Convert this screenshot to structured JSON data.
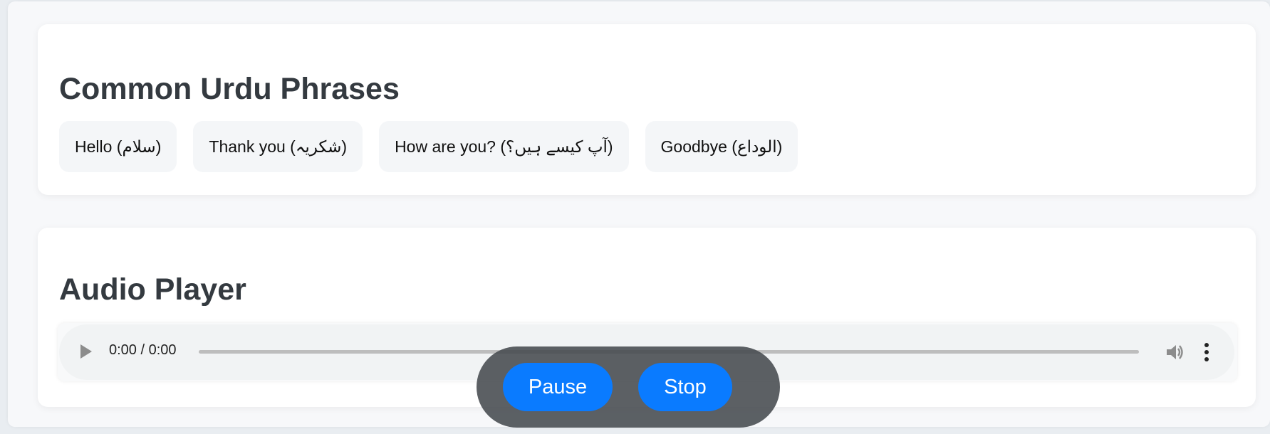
{
  "phrases_section": {
    "title": "Common Urdu Phrases",
    "phrases": [
      {
        "label": "Hello (سلام)"
      },
      {
        "label": "Thank you (شکریہ)"
      },
      {
        "label": "How are you? (آپ کیسے ہیں؟)"
      },
      {
        "label": "Goodbye (الوداع)"
      }
    ]
  },
  "audio_section": {
    "title": "Audio Player",
    "player": {
      "time_display": "0:00 / 0:00",
      "progress": 0,
      "play_icon": "play-icon",
      "volume_icon": "volume-icon",
      "menu_icon": "more-vertical-icon"
    }
  },
  "floating_controls": {
    "pause_label": "Pause",
    "stop_label": "Stop"
  },
  "colors": {
    "accent": "#0a7bff",
    "controls_bg": "#464a4e",
    "card_bg": "#ffffff",
    "chip_bg": "#f4f6f8"
  }
}
